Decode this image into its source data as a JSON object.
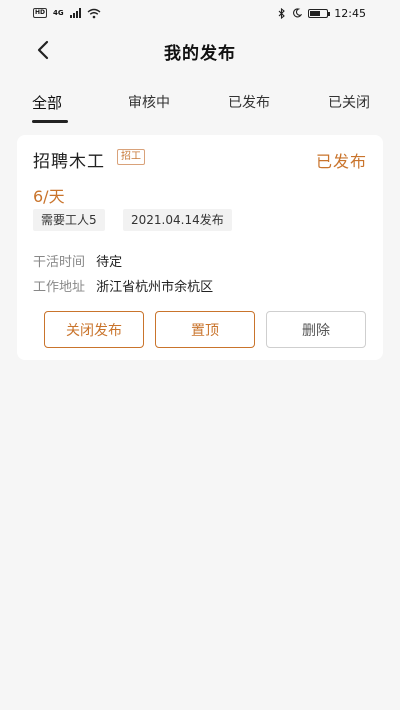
{
  "status_bar": {
    "hd_badge": "HD",
    "network": "4G",
    "time": "12:45",
    "icons": [
      "hd-badge",
      "signal-icon",
      "wifi-icon",
      "bluetooth-icon",
      "moon-icon",
      "battery-icon"
    ]
  },
  "header": {
    "title": "我的发布",
    "back_icon": "chevron-left-icon"
  },
  "tabs": [
    {
      "label": "全部",
      "active": true
    },
    {
      "label": "审核中",
      "active": false
    },
    {
      "label": "已发布",
      "active": false
    },
    {
      "label": "已关闭",
      "active": false
    }
  ],
  "job_card": {
    "title": "招聘木工",
    "tag": "招工",
    "status": "已发布",
    "wage": "6/天",
    "chips": [
      "需要工人5",
      "2021.04.14发布"
    ],
    "work_time": {
      "label": "干活时间",
      "value": "待定"
    },
    "work_address": {
      "label": "工作地址",
      "value": "浙江省杭州市余杭区"
    },
    "buttons": {
      "close": "关闭发布",
      "top": "置顶",
      "delete": "删除"
    }
  },
  "colors": {
    "accent": "#c9742c",
    "background": "#f6f6f6",
    "card": "#ffffff"
  }
}
